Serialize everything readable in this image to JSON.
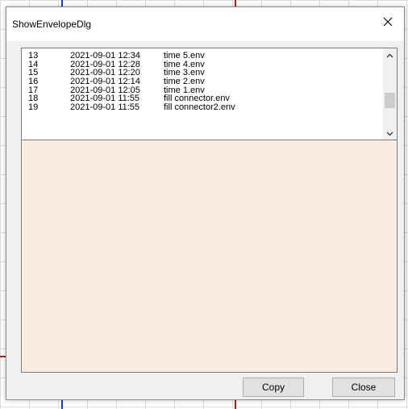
{
  "window": {
    "title": "ShowEnvelopeDlg",
    "close_icon": "close-icon"
  },
  "envelope_list": {
    "rows": [
      {
        "index": "13",
        "datetime": "2021-09-01 12:34",
        "name": "time 5.env"
      },
      {
        "index": "14",
        "datetime": "2021-09-01 12:28",
        "name": "time 4.env"
      },
      {
        "index": "15",
        "datetime": "2021-09-01 12:20",
        "name": "time 3.env"
      },
      {
        "index": "16",
        "datetime": "2021-09-01 12:14",
        "name": "time 2.env"
      },
      {
        "index": "17",
        "datetime": "2021-09-01 12:05",
        "name": "time 1.env"
      },
      {
        "index": "18",
        "datetime": "2021-09-01 11:55",
        "name": "fill connector.env"
      },
      {
        "index": "19",
        "datetime": "2021-09-01 11:55",
        "name": "fill connector2.env"
      }
    ],
    "scrollbar": {
      "up_icon": "chevron-up-icon",
      "down_icon": "chevron-down-icon"
    }
  },
  "canvas": {
    "background": "#f9ece3"
  },
  "buttons": {
    "copy_label": "Copy",
    "close_label": "Close"
  }
}
